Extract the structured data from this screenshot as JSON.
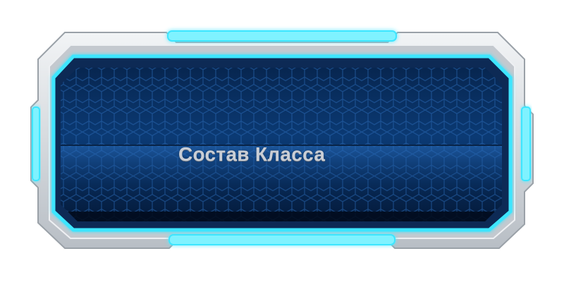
{
  "panel": {
    "title": "Состав Класса",
    "icons": {
      "top_light": "glow-bar-icon",
      "bottom_light": "glow-bar-icon",
      "left_light": "glow-bar-icon",
      "right_light": "glow-bar-icon"
    },
    "colors": {
      "frame_silver": "#d9dde2",
      "frame_shadow": "#8f959c",
      "glow_cyan": "#3ee6ff",
      "screen_dark": "#061f44",
      "screen_mid": "#0c3d7a",
      "hex_line": "#1f5da3",
      "title_text": "#c9ced6"
    }
  }
}
